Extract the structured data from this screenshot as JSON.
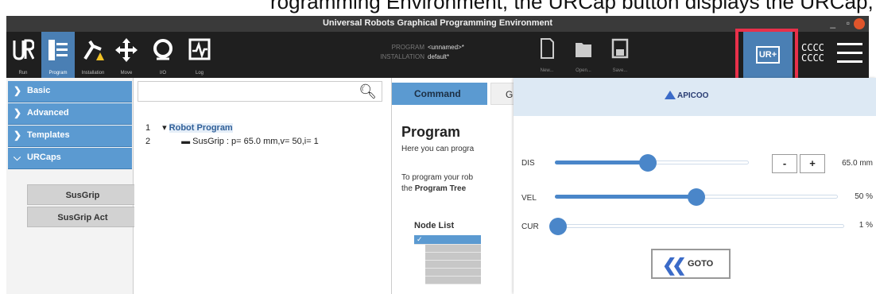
{
  "caption_text": "rogramming Environment, the URCap button displays the URCap, recognized by the UR+ icon to the top",
  "window": {
    "title": "Universal Robots Graphical Programming Environment",
    "minimize": "_",
    "maximize": "▫"
  },
  "toolbar": {
    "items": [
      {
        "label": "Run",
        "icon": "ur-logo-icon"
      },
      {
        "label": "Program",
        "icon": "program-tree-icon"
      },
      {
        "label": "Installation",
        "icon": "installation-icon"
      },
      {
        "label": "Move",
        "icon": "move-icon"
      },
      {
        "label": "I/O",
        "icon": "io-icon"
      },
      {
        "label": "Log",
        "icon": "log-icon"
      }
    ],
    "program_key": "PROGRAM",
    "program_value": "<unnamed>*",
    "installation_key": "INSTALLATION",
    "installation_value": "default*",
    "new_label": "New...",
    "open_label": "Open...",
    "save_label": "Save...",
    "urcap_glyph": "UR+",
    "cccc_line1": "CCCC",
    "cccc_line2": "CCCC"
  },
  "leftnav": {
    "basic": "Basic",
    "advanced": "Advanced",
    "templates": "Templates",
    "urcaps": "URCaps",
    "susgrip": "SusGrip",
    "susgrip_act": "SusGrip Act"
  },
  "tree": {
    "line1_num": "1",
    "line1": "Robot Program",
    "line2_num": "2",
    "line2": "SusGrip : p= 65.0 mm,v= 50,i= 1"
  },
  "command": {
    "tab": "Command",
    "tab2": "G",
    "title": "Program",
    "text1": "Here you can progra",
    "text2": "To program your rob",
    "text3a": "the ",
    "text3b": "Program Tree",
    "nodelist": "Node List"
  },
  "urcap_panel": {
    "logo": "APICOO",
    "dis_label": "DIS",
    "dis_value": "65.0 mm",
    "dis_fraction": 0.48,
    "minus": "-",
    "plus": "+",
    "vel_label": "VEL",
    "vel_value": "50 %",
    "vel_fraction": 0.5,
    "cur_label": "CUR",
    "cur_value": "1 %",
    "cur_fraction": 0.01,
    "goto": "GOTO"
  },
  "colors": {
    "accent": "#5b9ad1",
    "highlight": "#e8304a",
    "toolbar_bg": "#1f1f1f"
  }
}
